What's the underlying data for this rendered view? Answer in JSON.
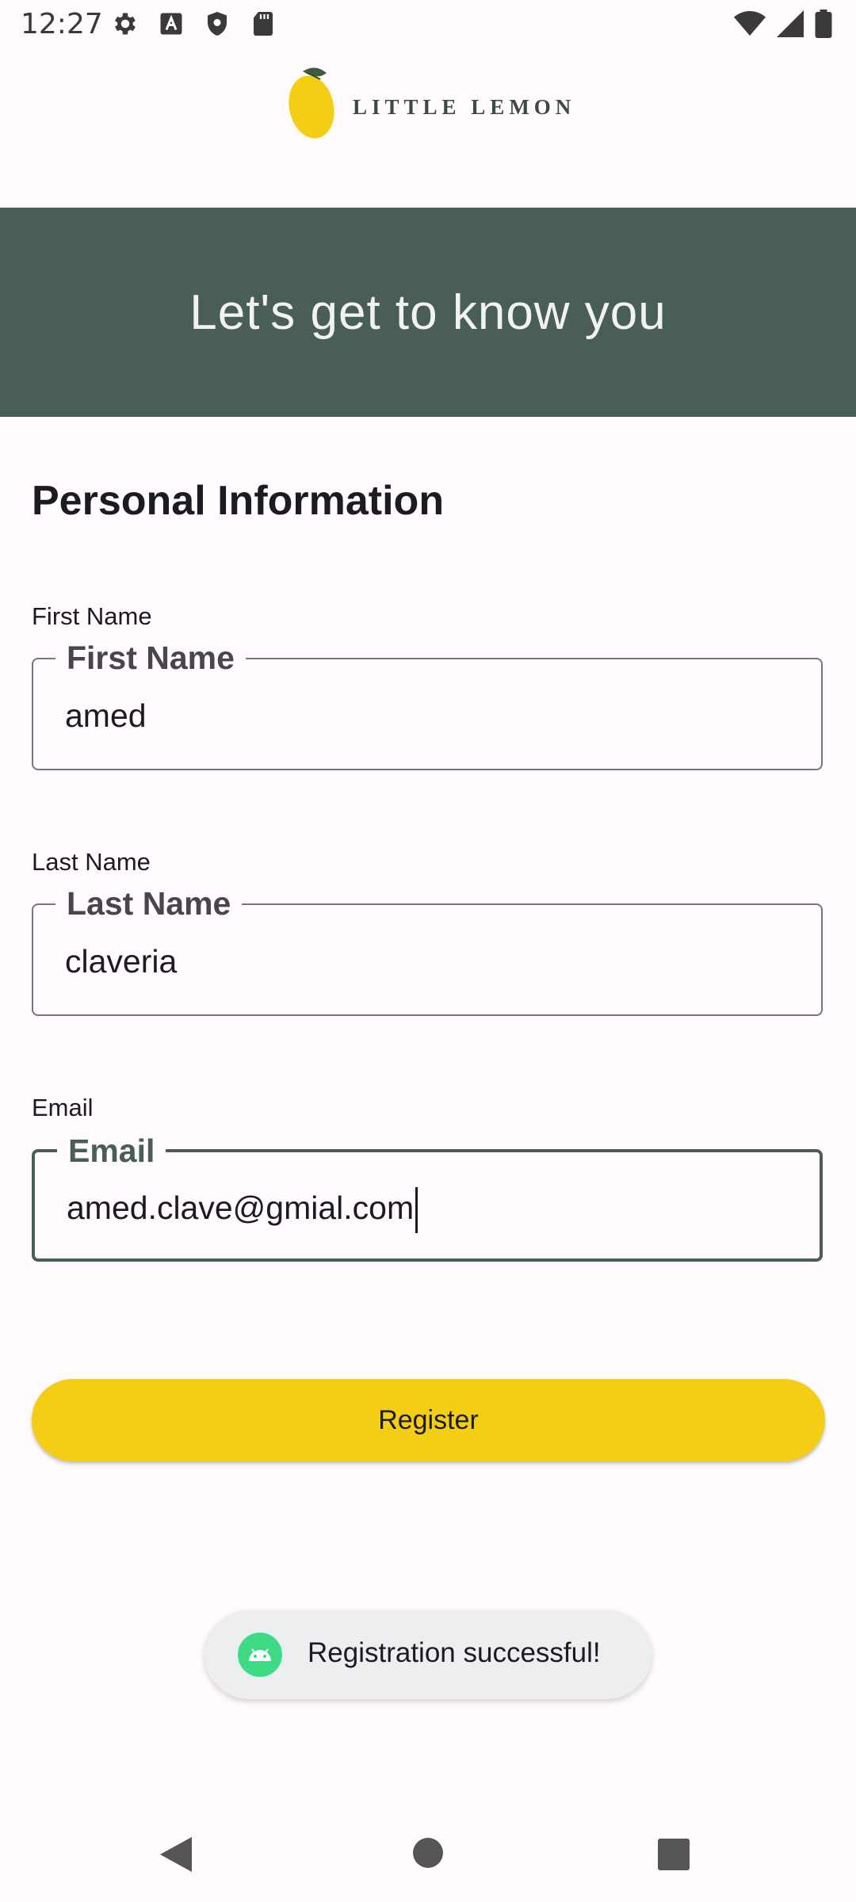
{
  "status_bar": {
    "time": "12:27",
    "left_icons": [
      "settings-icon",
      "a-icon",
      "shield-icon",
      "sd-card-icon"
    ],
    "right_icons": [
      "wifi-icon",
      "signal-icon",
      "battery-icon"
    ]
  },
  "logo": {
    "text": "LITTLE LEMON"
  },
  "hero": {
    "title": "Let's get to know you"
  },
  "section": {
    "title": "Personal Information"
  },
  "fields": {
    "first_name": {
      "label": "First Name",
      "legend": "First Name",
      "value": "amed"
    },
    "last_name": {
      "label": "Last Name",
      "legend": "Last Name",
      "value": "claveria"
    },
    "email": {
      "label": "Email",
      "legend": "Email",
      "value": "amed.clave@gmial.com",
      "focused": true
    }
  },
  "register_button": {
    "label": "Register"
  },
  "toast": {
    "text": "Registration successful!",
    "icon": "android-icon"
  },
  "nav_bar": {
    "icons": [
      "back-icon",
      "home-icon",
      "recents-icon"
    ]
  },
  "colors": {
    "primary": "#495e57",
    "accent": "#f4ce14",
    "background": "#fffbfe"
  }
}
